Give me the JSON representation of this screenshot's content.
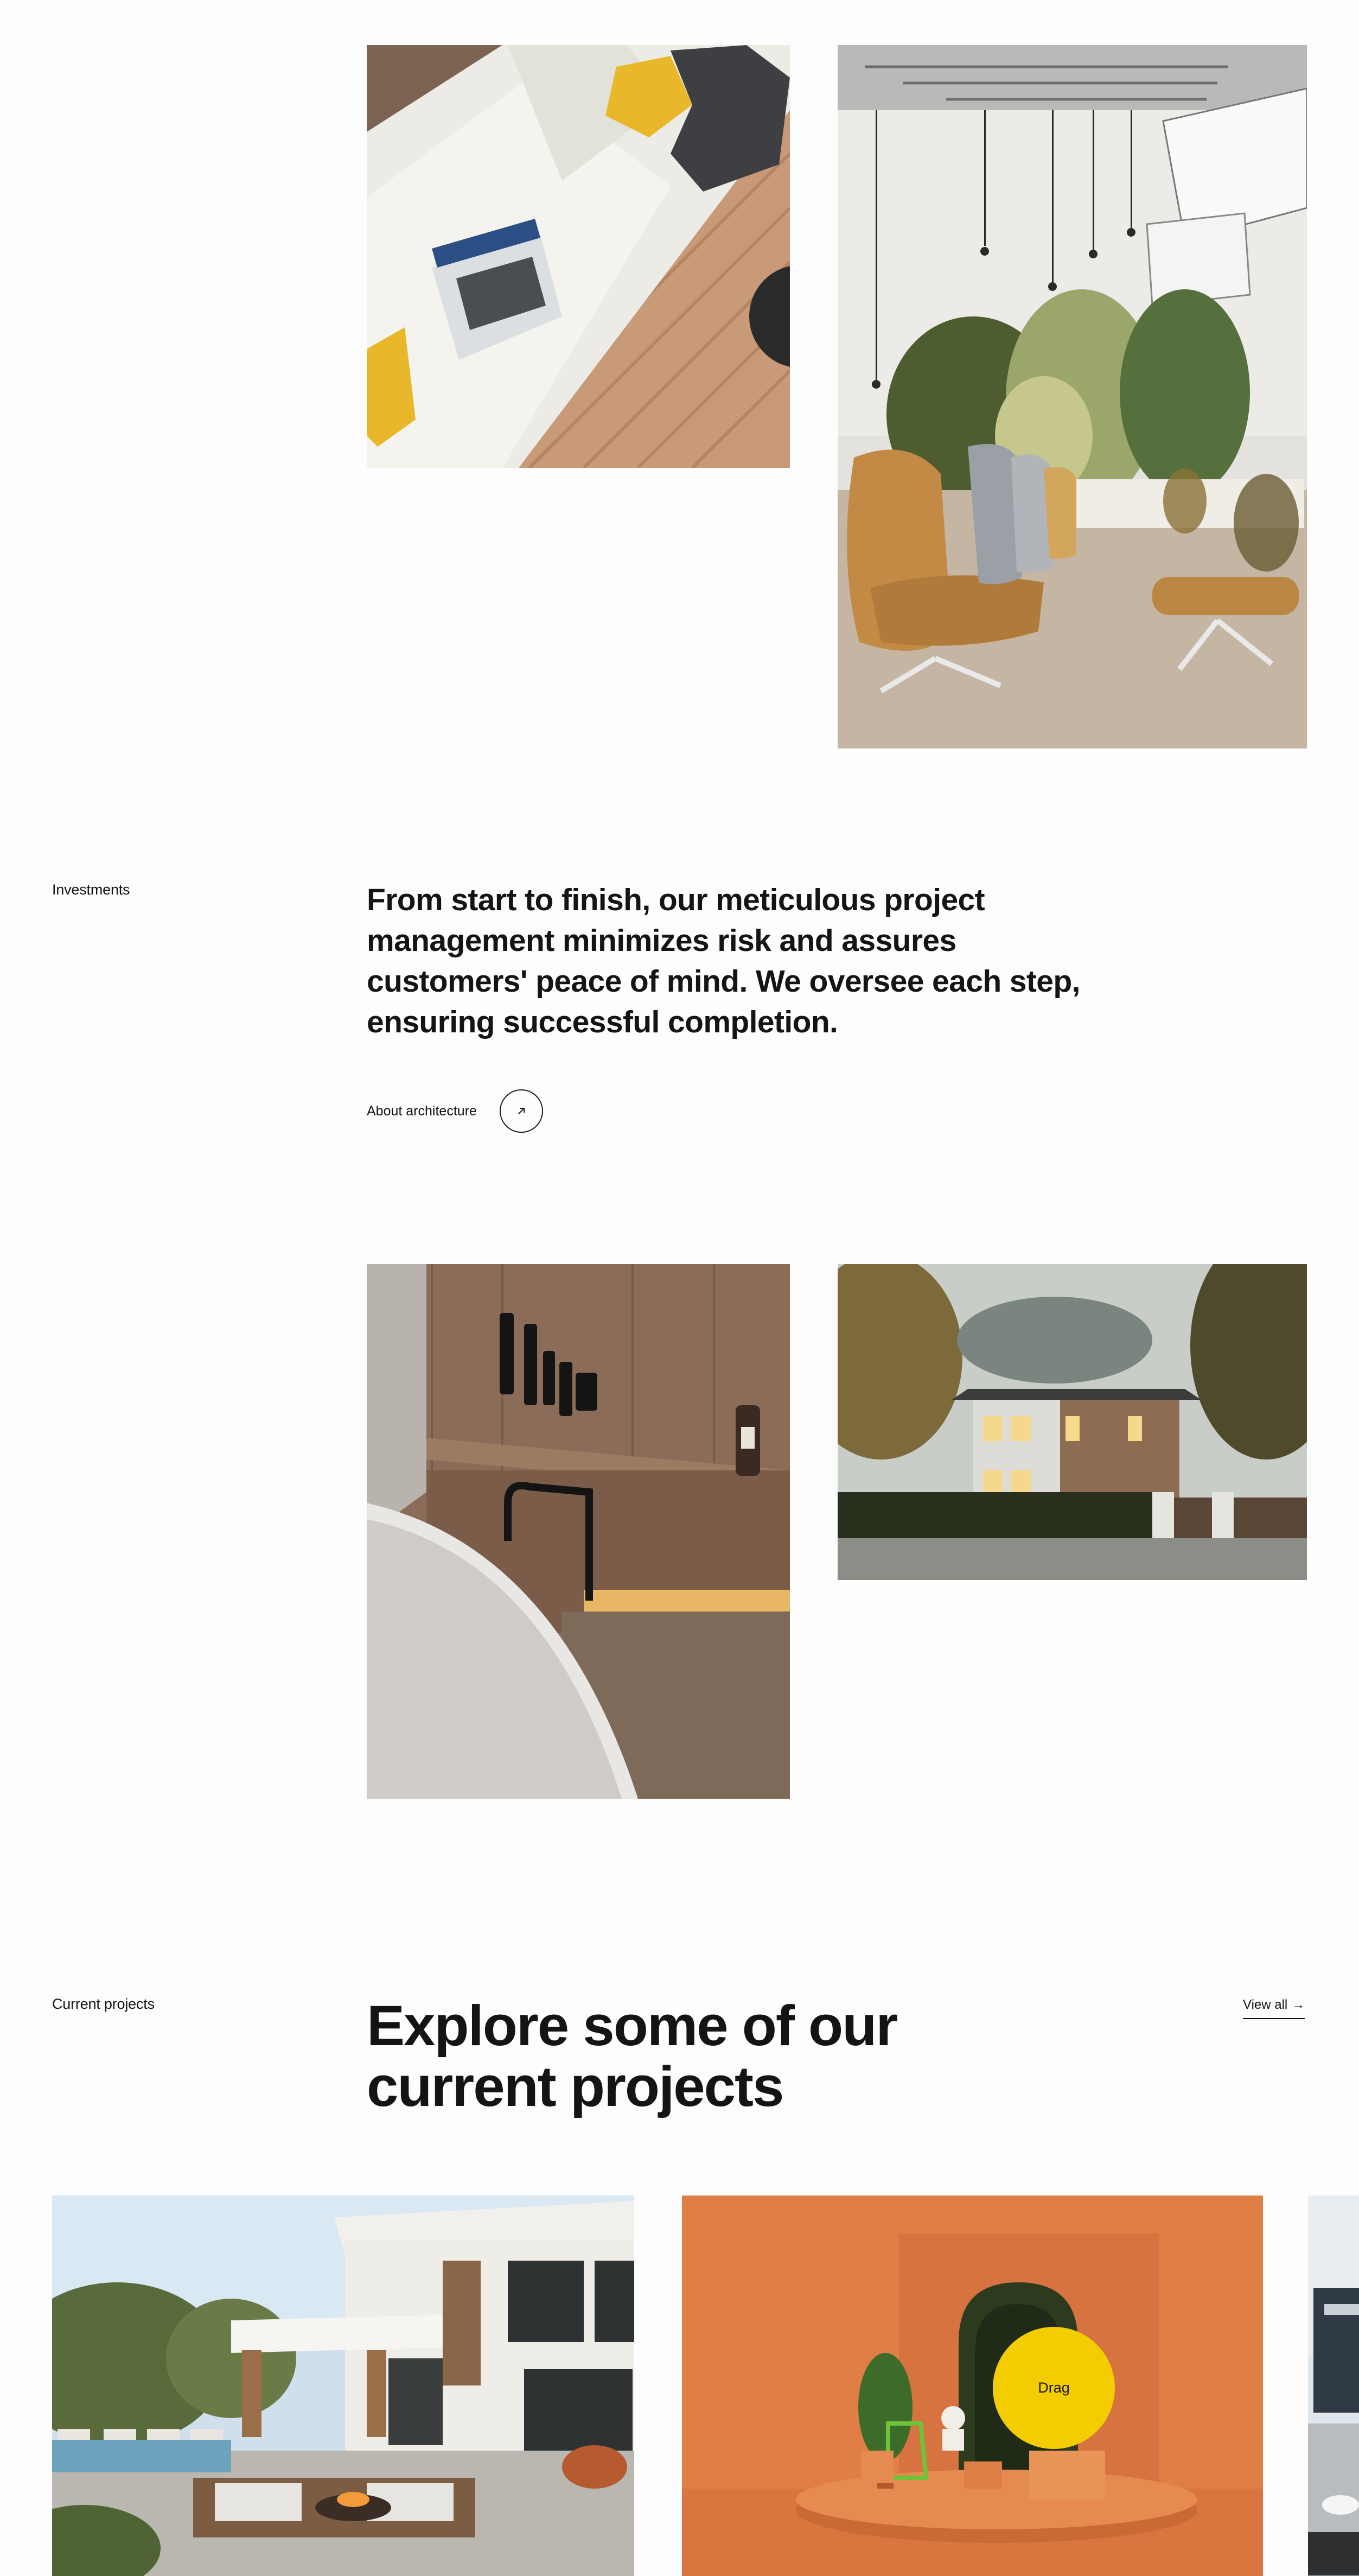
{
  "investments": {
    "label": "Investments",
    "lead_text": "From start to finish, our meticulous project management minimizes risk and assures customers' peace of mind. We oversee each step, ensuring successful completion.",
    "cta_label": "About architecture",
    "cta_icon": "arrow-up-right-icon"
  },
  "projects": {
    "label": "Current projects",
    "heading_line1": "Explore some of our",
    "heading_line2": "current projects",
    "view_all_label": "View all",
    "view_all_icon": "arrow-right-icon",
    "drag_label": "Drag"
  },
  "colors": {
    "accent_yellow": "#f4cd00",
    "text": "#141414",
    "background": "#fdfdfd",
    "terracotta": "#e07f45"
  }
}
